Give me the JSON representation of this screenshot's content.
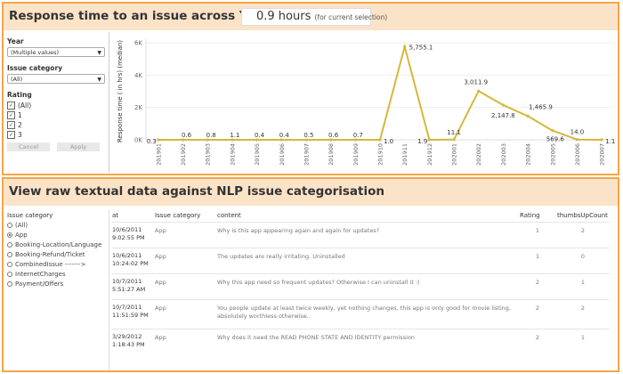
{
  "panel1": {
    "title": "Response time to an issue across Year-month",
    "metric_value": "0.9 hours",
    "metric_sub": "(for current selection)"
  },
  "filters": {
    "year_label": "Year",
    "year_value": "(Multiple values)",
    "category_label": "Issue category",
    "category_value": "(All)",
    "rating_label": "Rating",
    "rating_options": [
      "(All)",
      "1",
      "2",
      "3"
    ],
    "cancel": "Cancel",
    "apply": "Apply"
  },
  "chart_data": {
    "type": "line",
    "ylabel": "Response time ( in hrs) (median)",
    "yticks": [
      "0K",
      "2K",
      "4K",
      "6K"
    ],
    "ylim": [
      0,
      6000
    ],
    "color": "#d4b83a",
    "x": [
      "201901",
      "201902",
      "201903",
      "201904",
      "201905",
      "201906",
      "201907",
      "201908",
      "201909",
      "201910",
      "201911",
      "201912",
      "202001",
      "202002",
      "202003",
      "202004",
      "202005",
      "202006",
      "202007"
    ],
    "values": [
      0.3,
      0.6,
      0.8,
      1.1,
      0.4,
      0.4,
      0.5,
      0.6,
      0.7,
      1.0,
      5755.1,
      1.9,
      11.1,
      3011.9,
      2147.8,
      1465.9,
      569.6,
      14.0,
      1.1
    ],
    "labels": [
      "0.3",
      "0.6",
      "0.8",
      "1.1",
      "0.4",
      "0.4",
      "0.5",
      "0.6",
      "0.7",
      "1.0",
      "5,755.1",
      "1.9",
      "11.1",
      "3,011.9",
      "2,147.8",
      "1,465.9",
      "569.6",
      "14.0",
      "1.1"
    ]
  },
  "panel2": {
    "title": "View raw textual data against NLP issue categorisation",
    "cat_label": "Issue category",
    "cat_options": [
      "(All)",
      "App",
      "Booking-Location/Language",
      "Booking-Refund/Ticket",
      "CombinedIssue ------->",
      "InternetCharges",
      "Payment/Offers"
    ],
    "cat_selected": "App",
    "columns": [
      "at",
      "Issue category",
      "content",
      "Rating",
      "thumbsUpCount"
    ],
    "rows": [
      {
        "date": "10/6/2011",
        "time": "9:02:55 PM",
        "category": "App",
        "content": "Why is this app appearing again and again for updates?",
        "rating": "1",
        "thumbs": "2"
      },
      {
        "date": "10/6/2011",
        "time": "10:24:02 PM",
        "category": "App",
        "content": "The updates are really irritating. Uninstalled",
        "rating": "1",
        "thumbs": "0"
      },
      {
        "date": "10/7/2011",
        "time": "5:51:27 AM",
        "category": "App",
        "content": "Why this app need so frequent updates?  Otherwise I can uninstall it :(",
        "rating": "2",
        "thumbs": "1"
      },
      {
        "date": "10/7/2011",
        "time": "11:51:59 PM",
        "category": "App",
        "content": "You people update at least twice weekly, yet nothing changes, this app is only good for movie listing, absolutely worthless otherwise..",
        "rating": "2",
        "thumbs": "2"
      },
      {
        "date": "3/29/2012",
        "time": "1:18:43 PM",
        "category": "App",
        "content": "Why does it need the READ PHONE STATE AND IDENTITY permission",
        "rating": "2",
        "thumbs": "1"
      }
    ]
  }
}
